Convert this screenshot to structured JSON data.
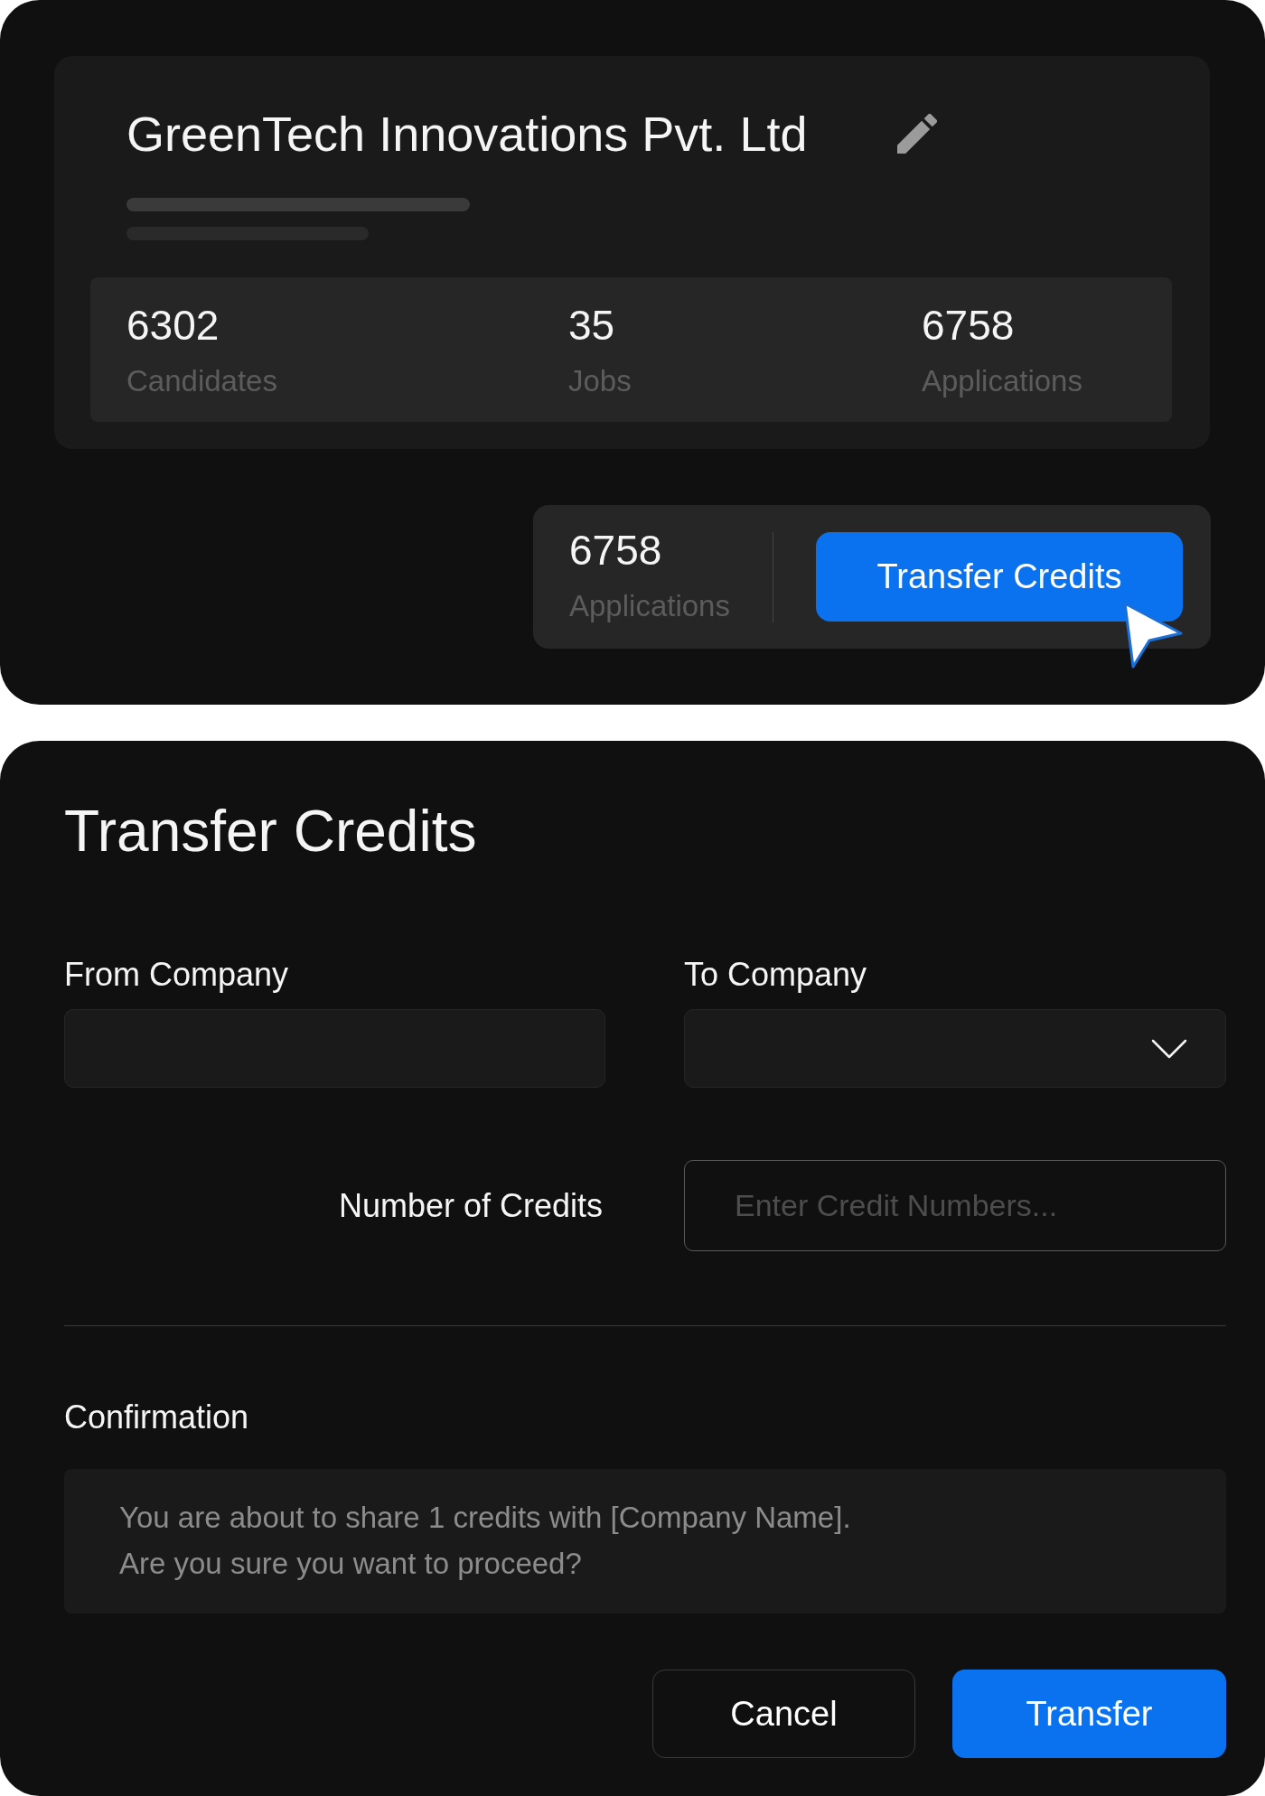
{
  "company_card": {
    "name": "GreenTech Innovations Pvt. Ltd",
    "stats": [
      {
        "value": "6302",
        "label": "Candidates"
      },
      {
        "value": "35",
        "label": "Jobs"
      },
      {
        "value": "6758",
        "label": "Applications"
      }
    ]
  },
  "credits_bar": {
    "value": "6758",
    "label": "Applications",
    "button": "Transfer Credits"
  },
  "transfer_dialog": {
    "title": "Transfer Credits",
    "from_company": {
      "label": "From Company"
    },
    "to_company": {
      "label": "To Company"
    },
    "credits": {
      "label": "Number of Credits",
      "placeholder": "Enter Credit Numbers..."
    },
    "confirmation": {
      "label": "Confirmation",
      "message_lines": [
        "You are about to share 1 credits with [Company Name].",
        "Are you sure you want to proceed?"
      ]
    },
    "buttons": [
      {
        "label": "Cancel",
        "kind": "secondary"
      },
      {
        "label": "Transfer",
        "kind": "primary"
      }
    ]
  }
}
